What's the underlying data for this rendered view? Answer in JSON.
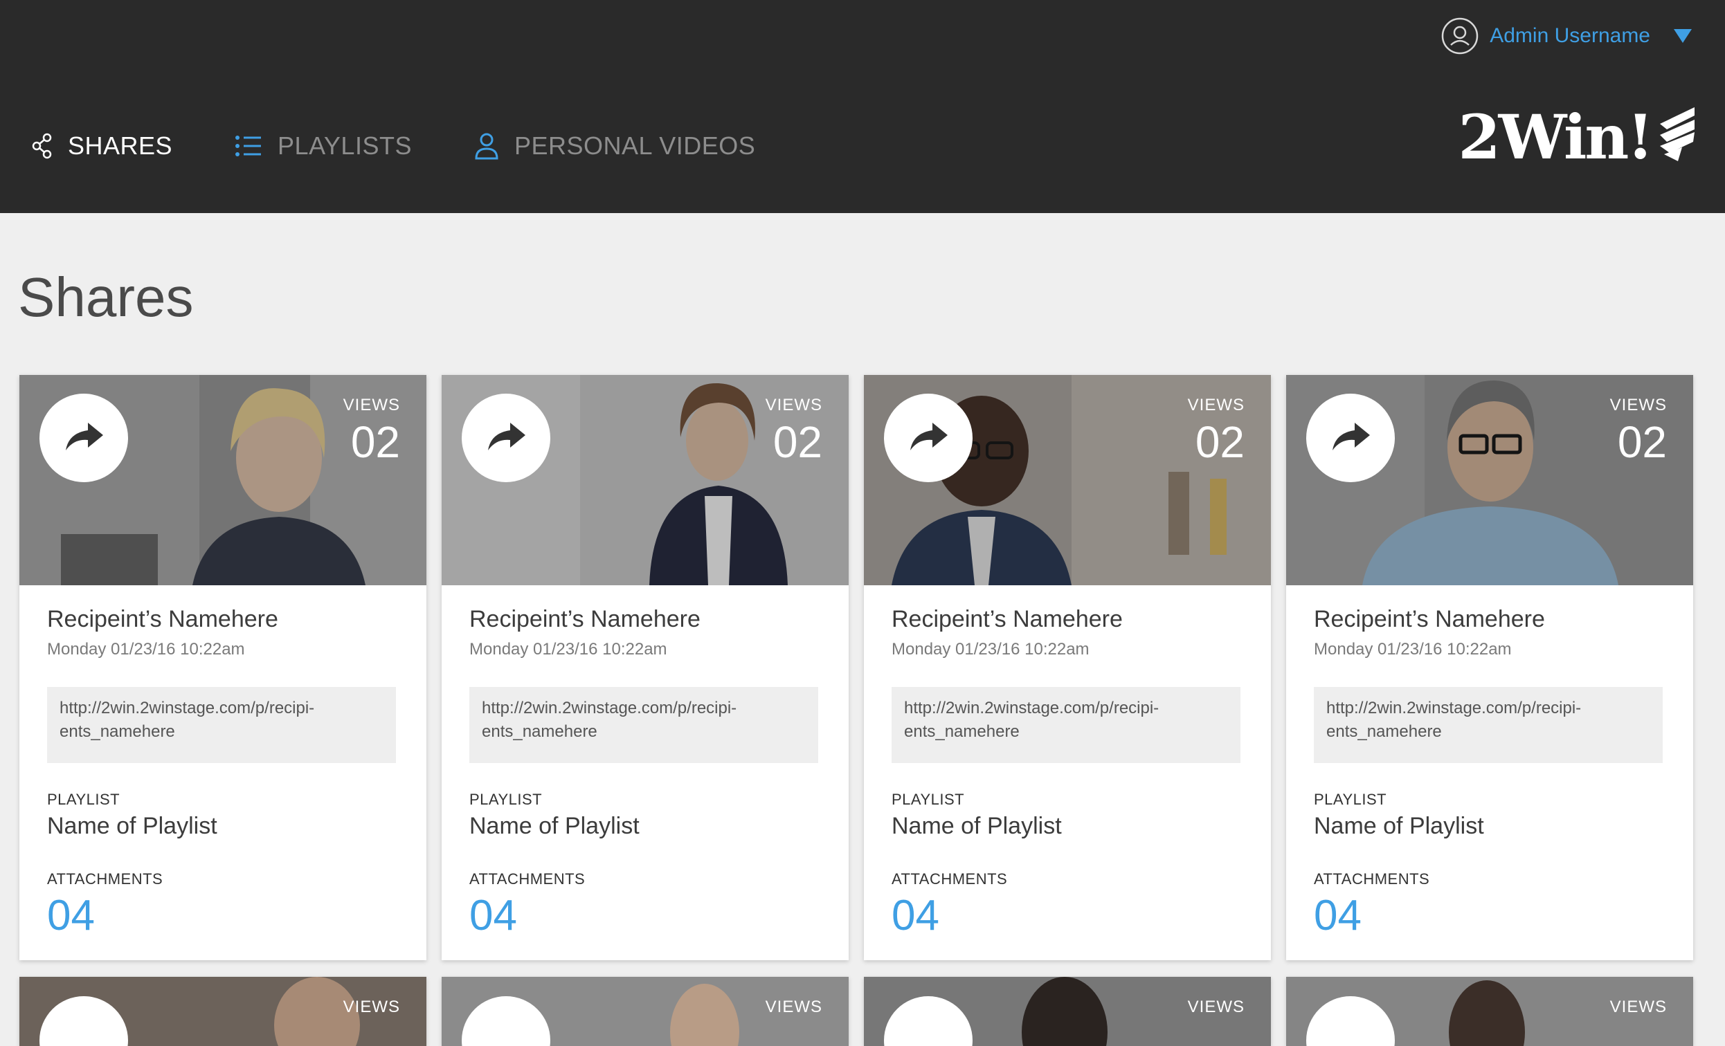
{
  "header": {
    "user_name": "Admin Username",
    "nav": [
      {
        "label": "SHARES",
        "icon": "share-icon",
        "active": true
      },
      {
        "label": "PLAYLISTS",
        "icon": "list-icon",
        "active": false
      },
      {
        "label": "PERSONAL VIDEOS",
        "icon": "person-icon",
        "active": false
      }
    ],
    "logo_text": "2Win!"
  },
  "page_title": "Shares",
  "cards": [
    {
      "views_label": "VIEWS",
      "views": "02",
      "recipient": "Recipeint’s Namehere",
      "date": "Monday 01/23/16 10:22am",
      "url_line1": "http://2win.2winstage.com/p/recipi-",
      "url_line2": "ents_namehere",
      "playlist_label": "PLAYLIST",
      "playlist": "Name of Playlist",
      "attachments_label": "ATTACHMENTS",
      "attachments": "04"
    },
    {
      "views_label": "VIEWS",
      "views": "02",
      "recipient": "Recipeint’s Namehere",
      "date": "Monday 01/23/16 10:22am",
      "url_line1": "http://2win.2winstage.com/p/recipi-",
      "url_line2": "ents_namehere",
      "playlist_label": "PLAYLIST",
      "playlist": "Name of Playlist",
      "attachments_label": "ATTACHMENTS",
      "attachments": "04"
    },
    {
      "views_label": "VIEWS",
      "views": "02",
      "recipient": "Recipeint’s Namehere",
      "date": "Monday 01/23/16 10:22am",
      "url_line1": "http://2win.2winstage.com/p/recipi-",
      "url_line2": "ents_namehere",
      "playlist_label": "PLAYLIST",
      "playlist": "Name of Playlist",
      "attachments_label": "ATTACHMENTS",
      "attachments": "04"
    },
    {
      "views_label": "VIEWS",
      "views": "02",
      "recipient": "Recipeint’s Namehere",
      "date": "Monday 01/23/16 10:22am",
      "url_line1": "http://2win.2winstage.com/p/recipi-",
      "url_line2": "ents_namehere",
      "playlist_label": "PLAYLIST",
      "playlist": "Name of Playlist",
      "attachments_label": "ATTACHMENTS",
      "attachments": "04"
    }
  ],
  "partial_cards": [
    {
      "views_label": "VIEWS"
    },
    {
      "views_label": "VIEWS"
    },
    {
      "views_label": "VIEWS"
    },
    {
      "views_label": "VIEWS"
    }
  ],
  "colors": {
    "header_bg": "#2a2a2a",
    "accent": "#3f9fe4",
    "page_bg": "#efefef"
  }
}
